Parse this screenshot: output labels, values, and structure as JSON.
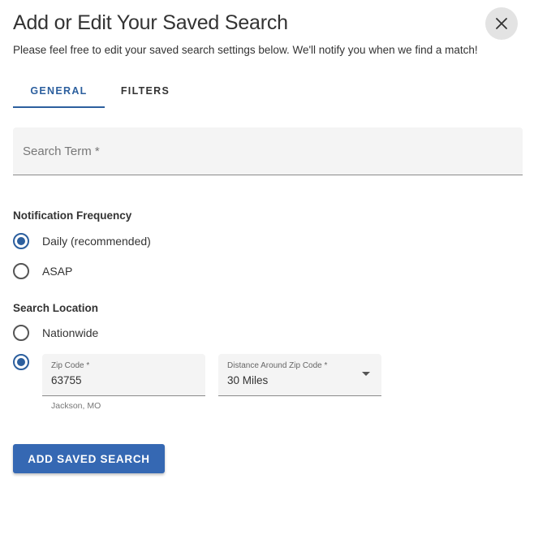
{
  "dialog": {
    "title": "Add or Edit Your Saved Search",
    "subtitle": "Please feel free to edit your saved search settings below. We'll notify you when we find a match!",
    "close_icon": "close-icon"
  },
  "tabs": [
    {
      "label": "GENERAL",
      "active": true
    },
    {
      "label": "FILTERS",
      "active": false
    }
  ],
  "search_term": {
    "placeholder": "Search Term *",
    "value": ""
  },
  "notification_frequency": {
    "label": "Notification Frequency",
    "options": [
      {
        "label": "Daily (recommended)",
        "checked": true
      },
      {
        "label": "ASAP",
        "checked": false
      }
    ]
  },
  "search_location": {
    "label": "Search Location",
    "options": [
      {
        "label": "Nationwide",
        "checked": false
      },
      {
        "label": "",
        "checked": true
      }
    ],
    "zip_code": {
      "label": "Zip Code *",
      "value": "63755",
      "helper": "Jackson, MO"
    },
    "distance": {
      "label": "Distance Around Zip Code *",
      "value": "30 Miles",
      "icon": "dropdown-arrow-icon"
    }
  },
  "submit_button": {
    "label": "ADD SAVED SEARCH"
  },
  "colors": {
    "accent": "#2c5f9e",
    "button": "#3568b3",
    "field_background": "#f4f4f4"
  }
}
